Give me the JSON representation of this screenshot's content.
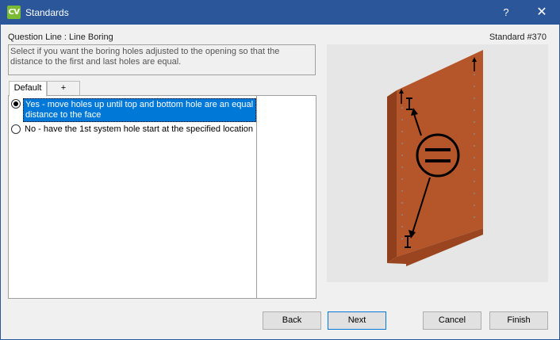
{
  "window": {
    "app_icon": "CV",
    "title": "Standards",
    "help_label": "?",
    "close_label": "✕"
  },
  "header": {
    "question_line": "Question Line : Line Boring",
    "standard_number": "Standard #370"
  },
  "description": "Select if you want the boring holes adjusted to the opening so that the distance to the first and last holes are equal.",
  "tabs": [
    {
      "label": "Default",
      "active": true
    },
    {
      "label": "+",
      "active": false
    }
  ],
  "options": [
    {
      "label": "Yes - move holes up until top and bottom hole are an equal distance to the face",
      "checked": true
    },
    {
      "label": "No - have the 1st system hole start at the specified location",
      "checked": false
    }
  ],
  "illustration": {
    "icon": "equal-sign-icon",
    "panel_color": "#b5552a"
  },
  "buttons": {
    "back": "Back",
    "next": "Next",
    "cancel": "Cancel",
    "finish": "Finish"
  },
  "colors": {
    "titlebar": "#2b579a",
    "selection": "#0078d7",
    "accent_icon": "#7bbb32"
  }
}
